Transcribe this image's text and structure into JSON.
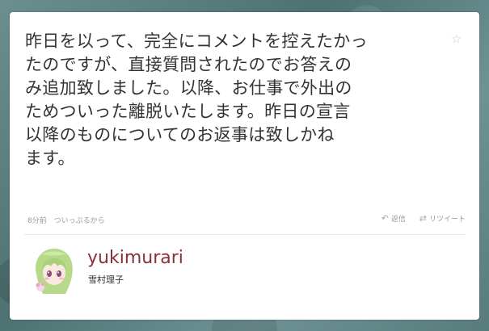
{
  "tweet": {
    "lines": [
      "昨日を以って、完全にコメントを控えたかっ",
      "たのですが、直接質問されたのでお答えの",
      "み追加致しました。以降、お仕事で外出の",
      "ためついった離脱いたします。昨日の宣言",
      "以降のものについてのお返事は致しかね",
      "ます。"
    ],
    "timestamp": "8分前",
    "source": "ついっぷるから",
    "reply_label": "返信",
    "retweet_label": "リツイート",
    "favorite_icon": "star-icon",
    "reply_icon": "reply-arrow-icon",
    "retweet_icon": "retweet-icon"
  },
  "user": {
    "screen_name": "yukimurari",
    "name": "雪村理子"
  },
  "colors": {
    "username": "#8a2f3c",
    "text": "#333333",
    "meta": "#999999",
    "card": "#ffffff"
  }
}
